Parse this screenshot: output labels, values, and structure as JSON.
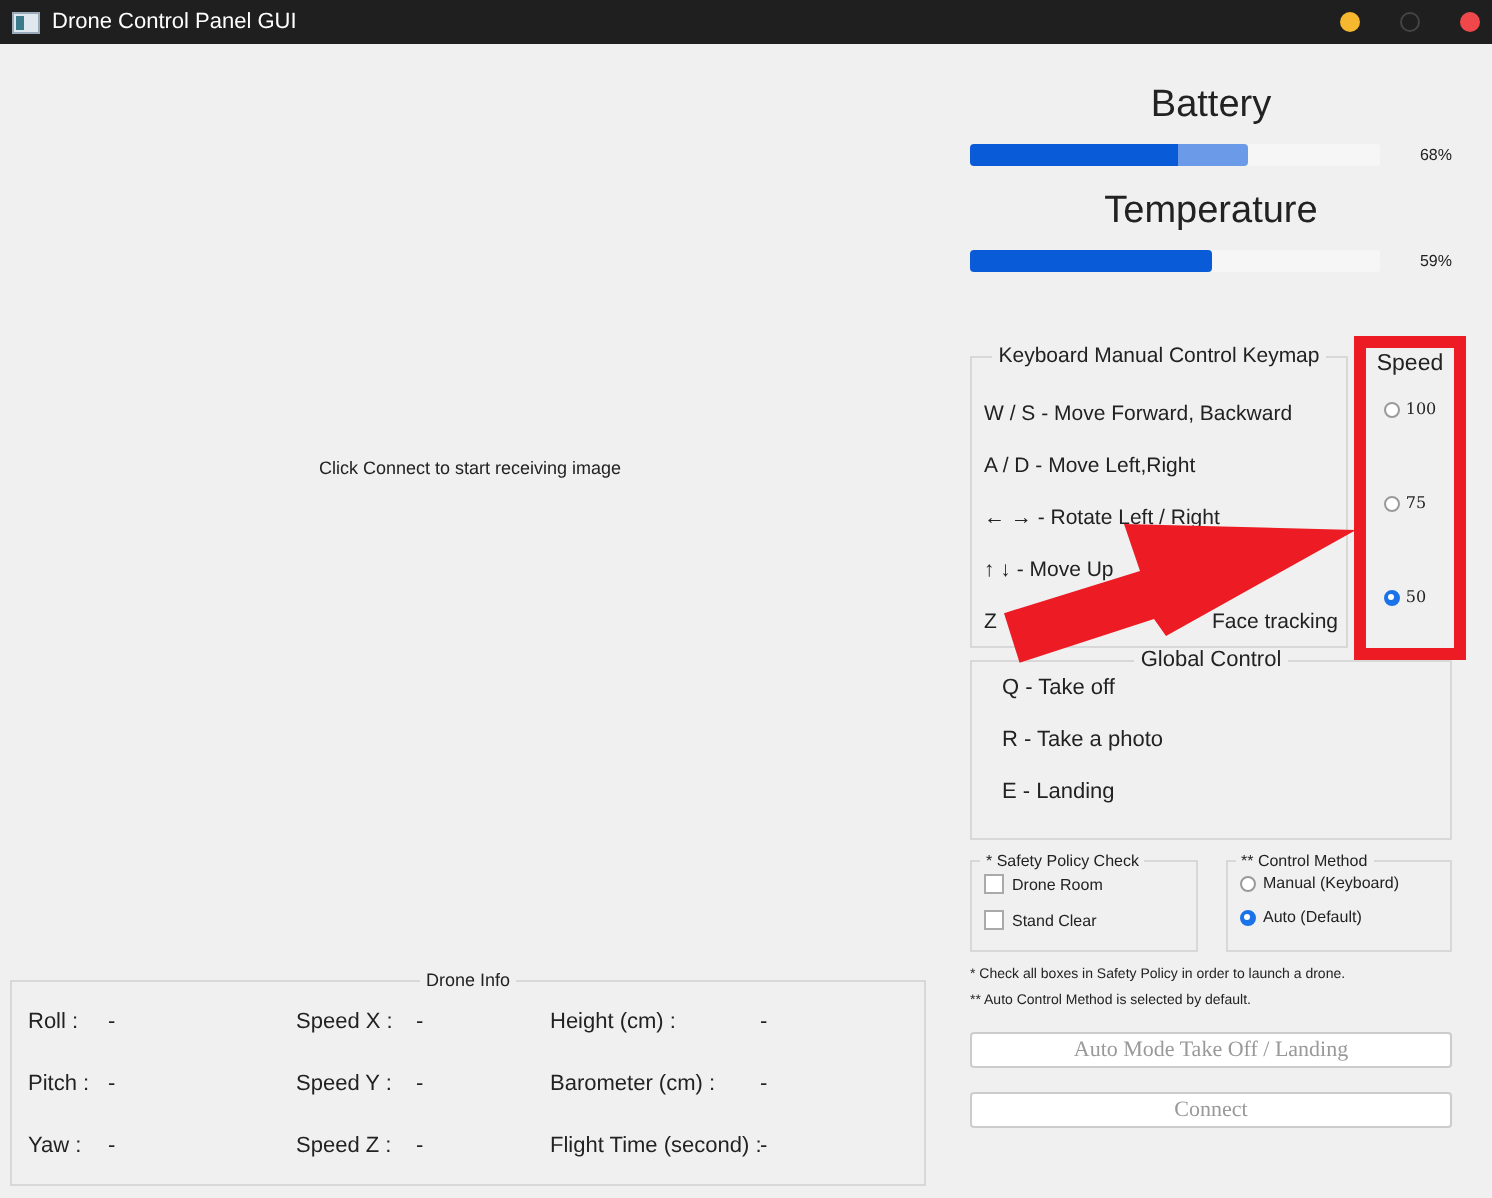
{
  "window": {
    "title": "Drone Control Panel GUI"
  },
  "video": {
    "message": "Click Connect to start receiving image"
  },
  "drone_info": {
    "title": "Drone Info",
    "fields": [
      {
        "label": "Roll :",
        "value": "-"
      },
      {
        "label": "Speed X :",
        "value": "-"
      },
      {
        "label": "Height (cm) :",
        "value": "-"
      },
      {
        "label": "Pitch :",
        "value": "-"
      },
      {
        "label": "Speed Y :",
        "value": "-"
      },
      {
        "label": "Barometer (cm) :",
        "value": "-"
      },
      {
        "label": "Yaw :",
        "value": "-"
      },
      {
        "label": "Speed Z :",
        "value": "-"
      },
      {
        "label": "Flight Time (second) :",
        "value": "-"
      }
    ]
  },
  "battery": {
    "title": "Battery",
    "level": 0.68,
    "reading": "68%"
  },
  "temperature": {
    "title": "Temperature",
    "level": 0.59,
    "reading": "59%"
  },
  "keymap": {
    "title": "Keyboard Manual Control Keymap",
    "rows": [
      {
        "text": "W / S - Move Forward, Backward"
      },
      {
        "text": "A / D - Move Left,Right"
      },
      {
        "text": "← → - Rotate Left / Right"
      },
      {
        "text": "↑ ↓ - Move Up"
      },
      {
        "text": "Z",
        "tail": "Face tracking"
      }
    ]
  },
  "speed": {
    "title": "Speed",
    "options": [
      {
        "label": "100",
        "selected": false
      },
      {
        "label": "75",
        "selected": false
      },
      {
        "label": "50",
        "selected": true
      }
    ]
  },
  "global_control": {
    "title": "Global Control",
    "rows": [
      "Q - Take off",
      "R - Take a photo",
      "E - Landing"
    ]
  },
  "safety": {
    "title": "* Safety Policy Check",
    "items": [
      {
        "label": "Drone Room",
        "checked": false
      },
      {
        "label": "Stand Clear",
        "checked": false
      }
    ]
  },
  "control_method": {
    "title": "** Control Method",
    "options": [
      {
        "label": "Manual (Keyboard)",
        "selected": false
      },
      {
        "label": "Auto (Default)",
        "selected": true
      }
    ]
  },
  "notes": [
    "* Check all boxes in Safety Policy in order to launch a drone.",
    "** Auto Control Method is selected by default."
  ],
  "buttons": [
    {
      "label": "Auto Mode Take Off / Landing",
      "disabled": true
    },
    {
      "label": "Connect",
      "disabled": true
    }
  ]
}
